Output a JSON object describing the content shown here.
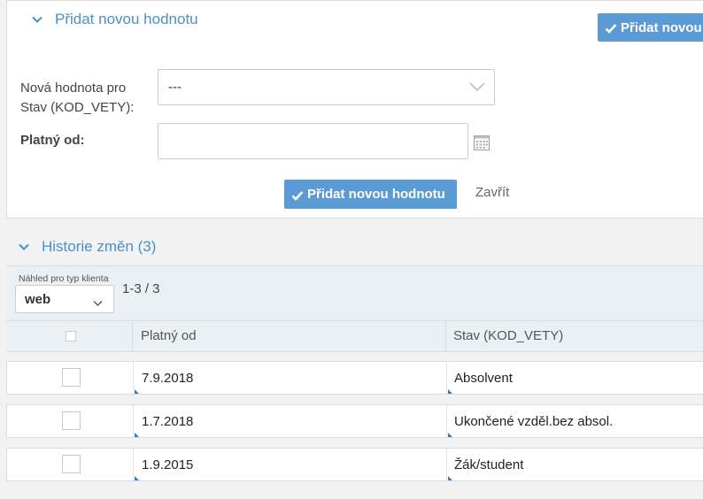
{
  "add_section": {
    "title": "Přidat novou hodnotu",
    "top_button": "Přidat novou",
    "field_value_label_line1": "Nová hodnota pro",
    "field_value_label_line2": "Stav (KOD_VETY):",
    "field_value_selected": "---",
    "field_date_label": "Platný od:",
    "field_date_value": "",
    "submit_button": "Přidat novou hodnotu",
    "close_link": "Zavřít"
  },
  "history": {
    "title": "Historie změn (3)",
    "client_view_caption": "Náhled pro typ klienta",
    "client_view_selected": "web",
    "count": "1-3 / 3",
    "columns": [
      "Platný od",
      "Stav (KOD_VETY)"
    ],
    "rows": [
      {
        "date": "7.9.2018",
        "state": "Absolvent"
      },
      {
        "date": "1.7.2018",
        "state": "Ukončené vzděl.bez absol."
      },
      {
        "date": "1.9.2015",
        "state": "Žák/student"
      }
    ]
  },
  "colors": {
    "accent": "#5b9bd5",
    "link": "#4a90c6",
    "header_bg": "#eaf0f4"
  }
}
